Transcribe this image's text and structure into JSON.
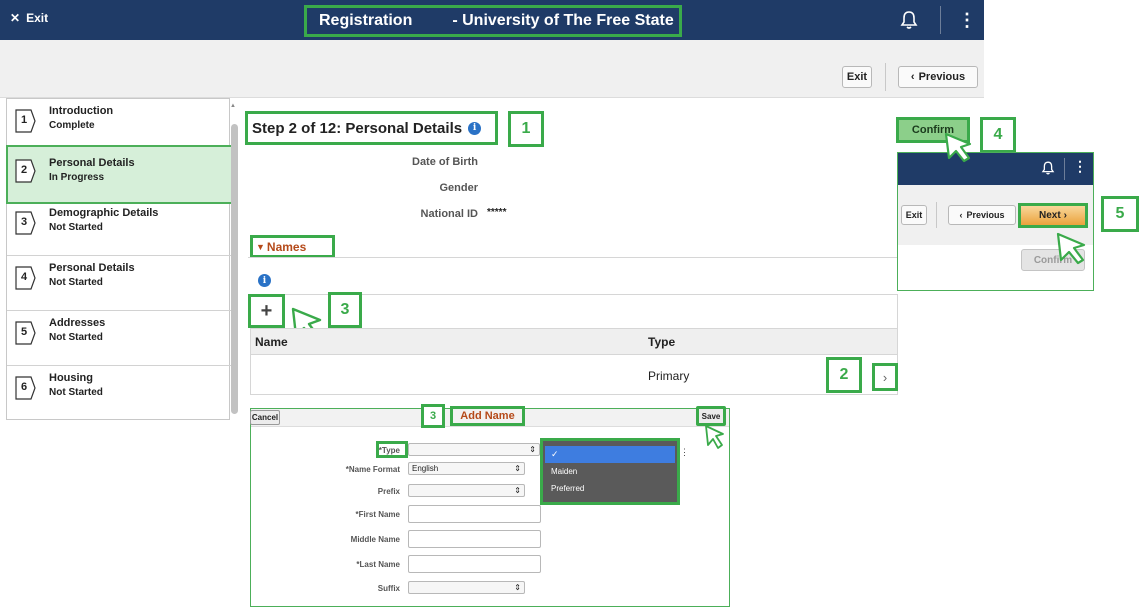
{
  "header": {
    "exit_label": "Exit",
    "title_left": "Registration",
    "title_right": "- University of The Free State"
  },
  "toolbar": {
    "exit_label": "Exit",
    "previous_label": "Previous"
  },
  "sidebar": {
    "items": [
      {
        "number": "1",
        "title": "Introduction",
        "status": "Complete"
      },
      {
        "number": "2",
        "title": "Personal Details",
        "status": "In Progress"
      },
      {
        "number": "3",
        "title": "Demographic Details",
        "status": "Not Started"
      },
      {
        "number": "4",
        "title": "Personal Details",
        "status": "Not Started"
      },
      {
        "number": "5",
        "title": "Addresses",
        "status": "Not Started"
      },
      {
        "number": "6",
        "title": "Housing",
        "status": "Not Started"
      }
    ]
  },
  "main": {
    "step_title": "Step 2 of 12: Personal Details",
    "fields": {
      "dob_label": "Date of Birth",
      "gender_label": "Gender",
      "national_id_label": "National ID",
      "national_id_value": "*****"
    },
    "names_section": "Names",
    "grid": {
      "col_name": "Name",
      "col_type": "Type",
      "rows": [
        {
          "name": "",
          "type": "Primary"
        }
      ]
    }
  },
  "add_name": {
    "cancel_label": "Cancel",
    "title": "Add Name",
    "save_label": "Save",
    "fields": {
      "type_label": "*Type",
      "name_format_label": "*Name Format",
      "name_format_value": "English",
      "prefix_label": "Prefix",
      "first_name_label": "*First Name",
      "middle_name_label": "Middle Name",
      "last_name_label": "*Last Name",
      "suffix_label": "Suffix"
    },
    "type_dropdown": {
      "selected": "✓",
      "options": [
        "Maiden",
        "Preferred"
      ]
    }
  },
  "inset": {
    "confirm_label": "Confirm",
    "exit_label": "Exit",
    "previous_label": "Previous",
    "next_label": "Next",
    "confirm_disabled_label": "Confirm"
  },
  "callouts": {
    "c1": "1",
    "c2": "2",
    "c3": "3",
    "c3b": "3",
    "c4": "4",
    "c5": "5"
  },
  "colors": {
    "header_bg": "#1f3b67",
    "callout_green": "#3aaa4a",
    "active_step_bg": "#d6efd9",
    "section_accent": "#b54a1a",
    "next_button": "#eba23c"
  }
}
